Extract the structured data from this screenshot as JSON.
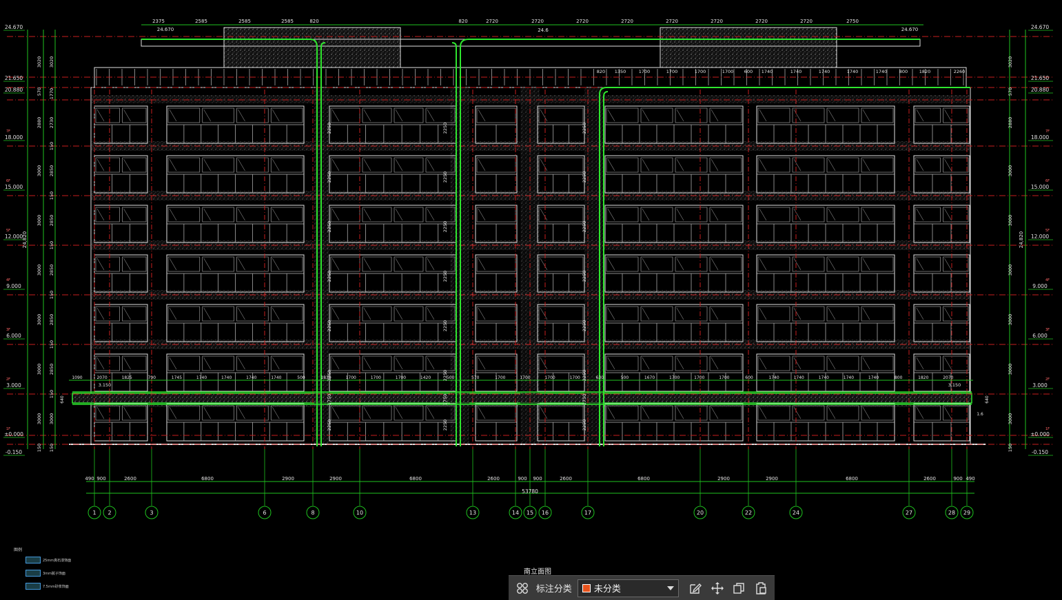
{
  "drawing": {
    "title": "南立面图",
    "total_width": "53780",
    "elev_labels_left": [
      "24.670",
      "21.650",
      "20.880",
      "18.000",
      "15.000",
      "12.000",
      "9.000",
      "6.000",
      "3.000",
      "±0.000",
      "-0.150"
    ],
    "elev_labels_right": [
      "24.670",
      "21.650",
      "20.880",
      "18.000",
      "15.000",
      "12.000",
      "9.000",
      "6.000",
      "3.000",
      "±0.000",
      "-0.150"
    ],
    "floor_tags_left": [
      "7F",
      "6F",
      "5F",
      "4F",
      "3F",
      "2F",
      "1F"
    ],
    "left_dims_inner": [
      "3020",
      "1770",
      "2730",
      "150",
      "2850",
      "150",
      "2850",
      "150",
      "2850",
      "150",
      "2850",
      "150",
      "2850",
      "150",
      "3000",
      "150"
    ],
    "left_dims_outer": [
      "3020",
      "570",
      "2880",
      "3000",
      "3000",
      "3000",
      "3000",
      "3000",
      "3000",
      "150"
    ],
    "height_total": "24,820",
    "top_dims_left": [
      "2375",
      "2585",
      "2585",
      "2585",
      "820"
    ],
    "top_dims_right": [
      "820",
      "2720",
      "2720",
      "2720",
      "2720",
      "2720",
      "2720",
      "2720",
      "2720",
      "2750"
    ],
    "roof_dims": [
      "820",
      "1350",
      "1700",
      "1700",
      "1700",
      "1700",
      "600",
      "1740",
      "1740",
      "1740",
      "1740",
      "1740",
      "800",
      "1820",
      "2260"
    ],
    "mid_dims": [
      "1090",
      "2070",
      "1825",
      "790",
      "1745",
      "1740",
      "1740",
      "1740",
      "1740",
      "500",
      "1830",
      "1700",
      "1700",
      "1700",
      "1420",
      "500",
      "570",
      "1700",
      "1700",
      "1700",
      "1700",
      "630",
      "500",
      "1670",
      "1700",
      "1700",
      "1700",
      "600",
      "1740",
      "1740",
      "1740",
      "1740",
      "1740",
      "800",
      "1820",
      "2070"
    ],
    "col_dims_left": [
      "2250",
      "2250",
      "2250",
      "2250",
      "2250",
      "2250",
      "1750",
      "2250"
    ],
    "bottom_dims": [
      "490",
      "900",
      "2600",
      "6800",
      "2900",
      "2900",
      "6800",
      "2600",
      "900",
      "900",
      "2600",
      "6800",
      "2900",
      "2900",
      "6800",
      "2600",
      "900",
      "490"
    ],
    "axes": [
      "1",
      "2",
      "3",
      "6",
      "8",
      "10",
      "13",
      "14",
      "15",
      "16",
      "17",
      "20",
      "22",
      "24",
      "27",
      "28",
      "29"
    ],
    "roof_label_left": "24.670",
    "roof_label_mid": "24.6",
    "roof_label_right": "24.670",
    "terrace_label_left": "3.150",
    "terrace_label_right": "3.150",
    "misc_left": "640",
    "misc_right": "640",
    "corner_label": "1.6"
  },
  "legend": {
    "heading": "图例",
    "items": [
      "25mm真石漆饰面",
      "3mm腻子饰面",
      "7.5mm砂浆饰面"
    ]
  },
  "toolbar": {
    "category_label": "标注分类",
    "category_value": "未分类",
    "category_color": "#e8531c"
  },
  "colors": {
    "background": "#000000",
    "axis_green": "#1fc41f",
    "dash_red": "#c81e1e",
    "outline_white": "#e0e0e0",
    "pipe_green": "#2ee62e"
  }
}
